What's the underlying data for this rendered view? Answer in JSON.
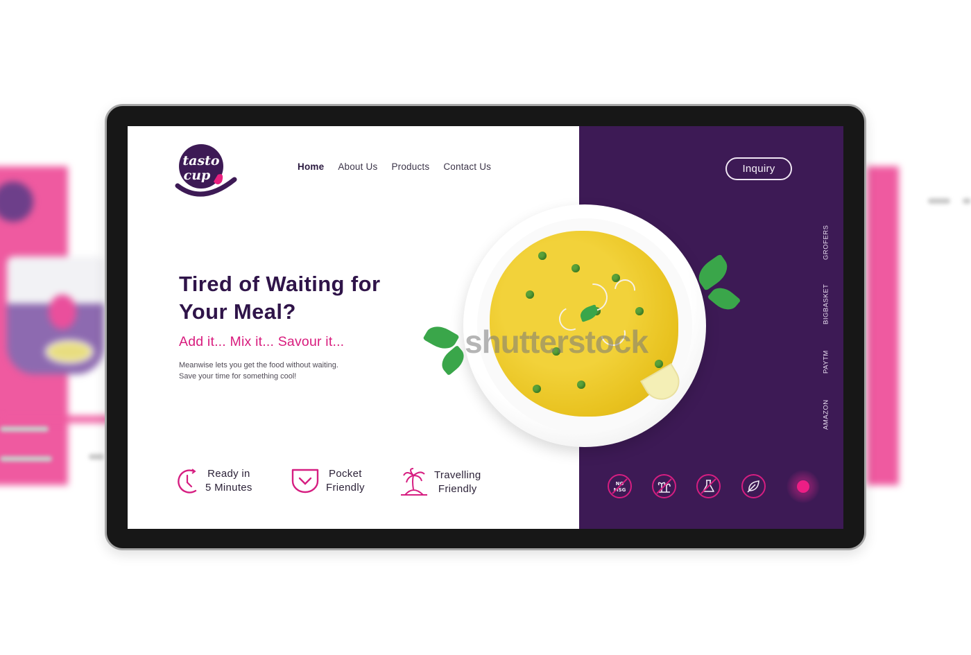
{
  "brand": {
    "logo_line1": "tasto",
    "logo_line2": "cup"
  },
  "nav": {
    "items": [
      {
        "label": "Home",
        "active": true
      },
      {
        "label": "About Us",
        "active": false
      },
      {
        "label": "Products",
        "active": false
      },
      {
        "label": "Contact Us",
        "active": false
      }
    ]
  },
  "header": {
    "inquiry_label": "Inquiry"
  },
  "hero": {
    "title": "Tired of Waiting for Your Meal?",
    "subtitle": "Add it... Mix it... Savour it...",
    "description_line1": "Meanwise lets you get the food without waiting.",
    "description_line2": "Save your time for something cool!"
  },
  "features": [
    {
      "icon": "clock-icon",
      "line1": "Ready in",
      "line2": "5 Minutes"
    },
    {
      "icon": "pocket-icon",
      "line1": "Pocket",
      "line2": "Friendly"
    },
    {
      "icon": "palm-island-icon",
      "line1": "Travelling",
      "line2": "Friendly"
    }
  ],
  "partners": [
    "GROFERS",
    "BIGBASKET",
    "PAYTM",
    "AMAZON"
  ],
  "badges": [
    {
      "icon": "no-msg-icon",
      "text_line1": "NO",
      "text_line2": "MSG"
    },
    {
      "icon": "no-palm-oil-icon"
    },
    {
      "icon": "no-chemicals-icon"
    },
    {
      "icon": "leaf-icon"
    }
  ],
  "image": {
    "watermark": "shutterstock"
  },
  "colors": {
    "primary_purple": "#3d1a55",
    "heading_purple": "#2f1449",
    "accent_pink": "#d81b7d",
    "frame": "#171717",
    "background_pink": "#ef5aa0"
  }
}
